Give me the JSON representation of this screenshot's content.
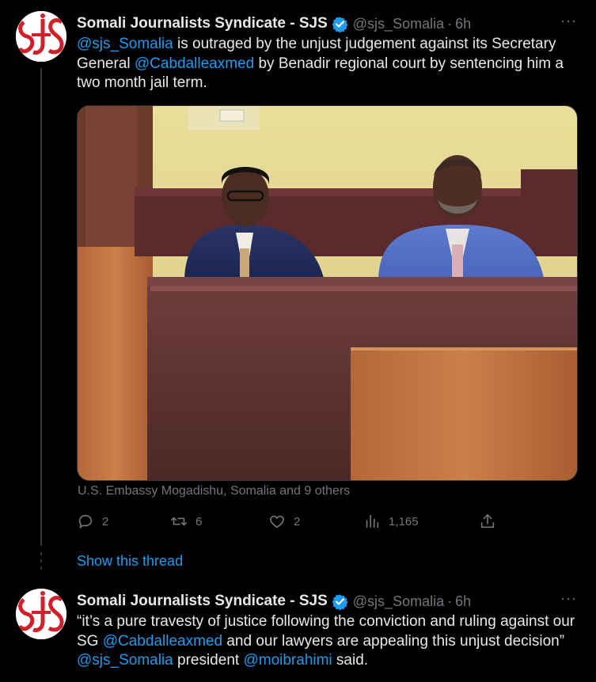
{
  "tweets": [
    {
      "author_name": "Somali Journalists Syndicate - SJS",
      "handle": "@sjs_Somalia",
      "separator": "·",
      "time": "6h",
      "more": "···",
      "text_parts": [
        {
          "type": "mention",
          "text": "@sjs_Somalia"
        },
        {
          "type": "text",
          "text": " is outraged by the unjust judgement against its Secretary General "
        },
        {
          "type": "mention",
          "text": "@Cabdalleaxmed"
        },
        {
          "type": "text",
          "text": "  by Benadir regional court by sentencing him a two month jail term."
        }
      ],
      "tagged": "U.S. Embassy Mogadishu, Somalia and 9 others",
      "actions": {
        "reply_count": "2",
        "retweet_count": "6",
        "like_count": "2",
        "view_count": "1,165"
      }
    },
    {
      "author_name": "Somali Journalists Syndicate - SJS",
      "handle": "@sjs_Somalia",
      "separator": "·",
      "time": "6h",
      "more": "···",
      "text_parts": [
        {
          "type": "text",
          "text": "“it’s a pure travesty of justice following the conviction and ruling against our SG "
        },
        {
          "type": "mention",
          "text": "@Cabdalleaxmed"
        },
        {
          "type": "text",
          "text": "  and our lawyers are appealing this unjust decision” "
        },
        {
          "type": "mention",
          "text": "@sjs_Somalia"
        },
        {
          "type": "text",
          "text": "  president "
        },
        {
          "type": "mention",
          "text": "@moibrahimi"
        },
        {
          "type": "text",
          "text": "  said."
        }
      ]
    }
  ],
  "show_thread": "Show this thread",
  "avatar_logo_text": "SJS",
  "colors": {
    "background": "#000000",
    "text": "#e7e9ea",
    "secondary": "#71767b",
    "accent": "#1d9bf0",
    "logo_red": "#d0202a"
  },
  "icons": {
    "verified": "verified-badge-icon",
    "reply": "reply-icon",
    "retweet": "retweet-icon",
    "like": "heart-icon",
    "views": "views-icon",
    "share": "share-icon",
    "more": "more-icon"
  }
}
